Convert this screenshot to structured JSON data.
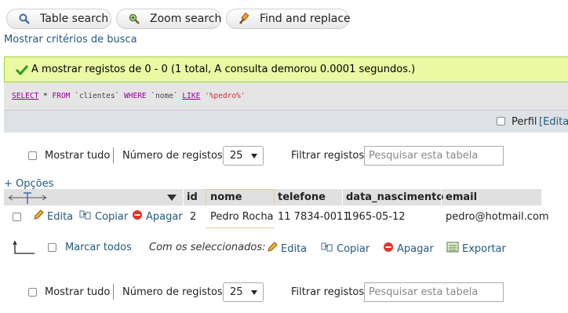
{
  "tabs": [
    {
      "label": "Table search",
      "icon": "search-icon"
    },
    {
      "label": "Zoom search",
      "icon": "zoom-search-icon"
    },
    {
      "label": "Find and replace",
      "icon": "find-replace-icon"
    }
  ],
  "show_criteria_link": "Mostrar critérios de busca",
  "success_message": "A mostrar registos de 0 - 0 (1 total, A consulta demorou 0.0001 segundos.)",
  "sql": {
    "select": "SELECT",
    "star": " * ",
    "from": "FROM",
    "table": " `clientes` ",
    "where": "WHERE",
    "column": " `nome` ",
    "like": "LIKE",
    "value": " '%pedro%'"
  },
  "profile": {
    "label": "Perfil",
    "edit_link": "[Editar"
  },
  "nav": {
    "show_all": "Mostrar tudo",
    "rows_label": "Número de registos:",
    "rows_value": "25",
    "filter_label": "Filtrar registos:",
    "filter_placeholder": "Pesquisar esta tabela"
  },
  "options_link": "+ Opções",
  "columns": [
    "id",
    "nome",
    "telefone",
    "data_nascimento",
    "email"
  ],
  "row_actions": {
    "edit": "Edita",
    "copy": "Copiar",
    "delete": "Apagar"
  },
  "rows": [
    {
      "id": "2",
      "nome": "Pedro Rocha",
      "telefone": "11 7834-0011",
      "data_nascimento": "1965-05-12",
      "email": "pedro@hotmail.com"
    }
  ],
  "bulk": {
    "check_all": "Marcar todos",
    "with_selected": "Com os seleccionados:",
    "edit": "Edita",
    "copy": "Copiar",
    "delete": "Apagar",
    "export": "Exportar"
  },
  "colors": {
    "link": "#235a81",
    "success_bg": "#ebf8a4",
    "success_border": "#a2d246",
    "delete_icon": "#e6332a",
    "check": "#2a9d1f"
  }
}
